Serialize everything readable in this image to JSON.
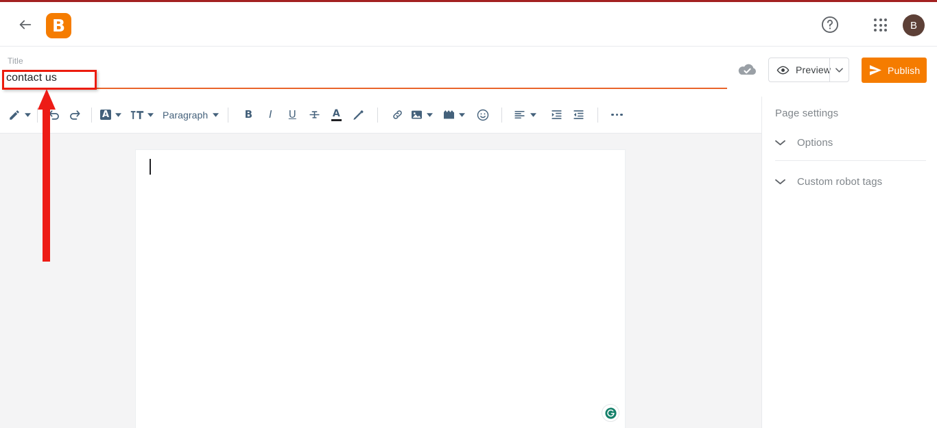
{
  "app": {
    "name": "Blogger",
    "logo_letter": "B",
    "accent_orange": "#f57c00",
    "annotation_red": "#ec1c0d",
    "top_border_color": "#a32121"
  },
  "appbar": {
    "back_icon": "arrow-back-icon",
    "logo_icon": "blogger-logo-icon",
    "help_icon": "help-circle-icon",
    "apps_icon": "apps-grid-icon",
    "avatar_letter": "B"
  },
  "title_field": {
    "label": "Title",
    "value": "contact us",
    "placeholder": "Title",
    "underline_color": "#e8642a",
    "highlighted": true
  },
  "actions": {
    "saved_icon": "cloud-done-icon",
    "preview_label": "Preview",
    "preview_icon": "eye-icon",
    "preview_caret_icon": "chevron-down-icon",
    "publish_label": "Publish",
    "publish_icon": "send-icon"
  },
  "toolbar": {
    "items": [
      {
        "name": "pen-tool",
        "icon": "pencil-icon",
        "caret": true
      },
      {
        "name": "separator"
      },
      {
        "name": "undo",
        "icon": "undo-icon",
        "caret": false
      },
      {
        "name": "redo",
        "icon": "redo-icon",
        "caret": false
      },
      {
        "name": "separator"
      },
      {
        "name": "background-color",
        "icon": "background-color-icon",
        "caret": true
      },
      {
        "name": "font-size",
        "icon": "font-size-icon",
        "caret": true
      },
      {
        "name": "paragraph-style",
        "label": "Paragraph",
        "caret": true
      },
      {
        "name": "separator"
      },
      {
        "name": "bold",
        "label": "B",
        "caret": false
      },
      {
        "name": "italic",
        "label": "I",
        "caret": false
      },
      {
        "name": "underline",
        "label": "U",
        "caret": false
      },
      {
        "name": "strikethrough",
        "icon": "strikethrough-icon",
        "caret": false
      },
      {
        "name": "text-color",
        "icon": "text-color-icon",
        "caret": false
      },
      {
        "name": "highlight",
        "icon": "marker-icon",
        "caret": false
      },
      {
        "name": "separator"
      },
      {
        "name": "link",
        "icon": "link-icon",
        "caret": false
      },
      {
        "name": "image",
        "icon": "image-icon",
        "caret": true
      },
      {
        "name": "video",
        "icon": "video-icon",
        "caret": true
      },
      {
        "name": "emoji",
        "icon": "emoji-icon",
        "caret": false
      },
      {
        "name": "separator"
      },
      {
        "name": "align",
        "icon": "align-left-icon",
        "caret": true
      },
      {
        "name": "indent-increase",
        "icon": "indent-increase-icon",
        "caret": false
      },
      {
        "name": "indent-decrease",
        "icon": "indent-decrease-icon",
        "caret": false
      },
      {
        "name": "separator"
      },
      {
        "name": "more-options",
        "icon": "more-horizontal-icon",
        "caret": false
      }
    ],
    "paragraph_label": "Paragraph",
    "bold_label": "B",
    "italic_label": "I",
    "underline_label": "U"
  },
  "editor": {
    "content": "",
    "cursor_visible": true,
    "grammarly_icon": "grammarly-icon",
    "grammarly_letter": "G",
    "grammarly_color": "#15806a"
  },
  "sidebar": {
    "title": "Page settings",
    "rows": [
      {
        "label": "Options",
        "icon": "chevron-down-icon"
      },
      {
        "label": "Custom robot tags",
        "icon": "chevron-down-icon"
      }
    ]
  },
  "annotation": {
    "arrow_name": "red-pointer-arrow",
    "arrow_color": "#ec1c0d",
    "points_to": "title-field"
  }
}
